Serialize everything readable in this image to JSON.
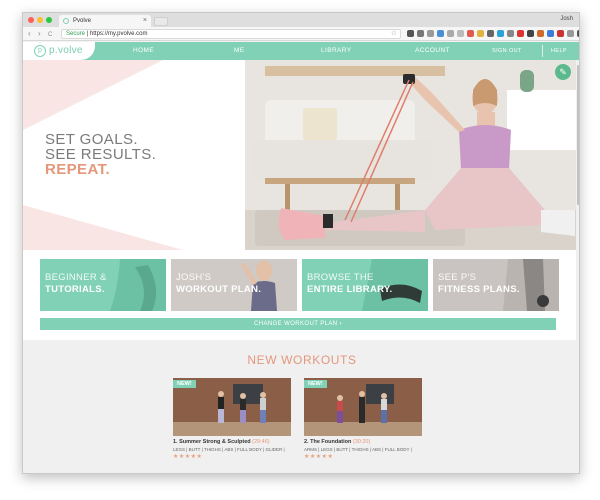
{
  "browser": {
    "tab_title": "Pvolve",
    "tab_close": "×",
    "profile_name": "Josh",
    "back": "‹",
    "forward": "›",
    "reload": "C",
    "secure_label": "Secure",
    "url": "https://my.pvolve.com",
    "bookmark_star": "☆"
  },
  "site": {
    "logo_mark": "p",
    "logo_text": "p.volve",
    "nav": {
      "home": "HOME",
      "me": "ME",
      "library": "LIBRARY",
      "account": "ACCOUNT",
      "signout": "SIGN OUT",
      "help": "HELP"
    }
  },
  "hero": {
    "line1": "SET GOALS.",
    "line2": "SEE RESULTS.",
    "line3": "REPEAT.",
    "edit_icon": "✎"
  },
  "tiles": [
    {
      "line1": "BEGINNER &",
      "line2": "TUTORIALS.",
      "color": "#80d1b5"
    },
    {
      "line1": "JOSH'S",
      "line2": "WORKOUT PLAN.",
      "color": "#c9c4c1"
    },
    {
      "line1": "BROWSE THE",
      "line2": "ENTIRE LIBRARY.",
      "color": "#80d1b5"
    },
    {
      "line1": "SEE P'S",
      "line2": "FITNESS PLANS.",
      "color": "#c9c4c1"
    }
  ],
  "change_plan": "CHANGE WORKOUT PLAN  ›",
  "new_workouts": {
    "title": "NEW WORKOUTS",
    "cards": [
      {
        "badge": "NEW!",
        "title": "1. Summer Strong & Sculpted",
        "length": "(29:46)",
        "tags": "LEGS | BUTT | THIGHS | ABS | FULL BODY | GLIDER |",
        "stars": "★★★★★"
      },
      {
        "badge": "NEW!",
        "title": "2. The Foundation",
        "length": "(30:20)",
        "tags": "ARMS | LEGS | BUTT | THIGHS | ABS | FULL BODY |",
        "stars": "★★★★★"
      }
    ]
  },
  "colors": {
    "mint": "#80d1b5",
    "coral": "#e4977b",
    "pink_bg": "#f9e6e4",
    "gray_tile": "#c9c4c1"
  }
}
